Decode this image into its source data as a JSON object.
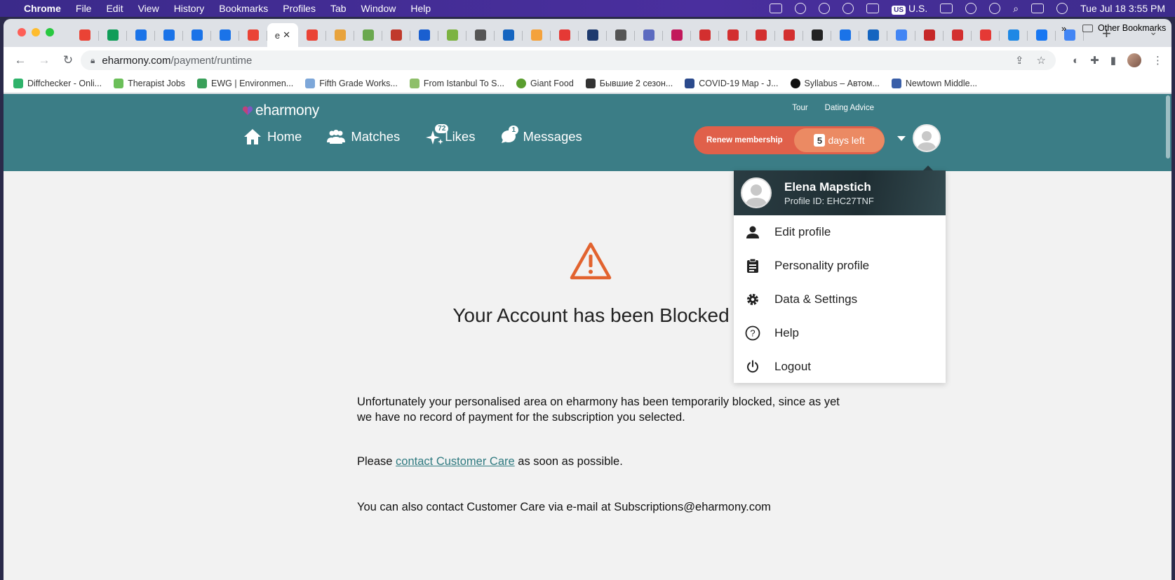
{
  "menubar": {
    "app": "Chrome",
    "items": [
      "File",
      "Edit",
      "View",
      "History",
      "Bookmarks",
      "Profiles",
      "Tab",
      "Window",
      "Help"
    ],
    "keyboard": "U.S.",
    "datetime": "Tue Jul 18  3:55 PM"
  },
  "browser": {
    "url_domain": "eharmony.com",
    "url_path": "/payment/runtime",
    "active_tab_label": "e",
    "bookmarks": [
      {
        "label": "Diffchecker - Onli...",
        "color": "#2fb36b"
      },
      {
        "label": "Therapist Jobs",
        "color": "#6bbf59"
      },
      {
        "label": "EWG | Environmen...",
        "color": "#3aa05a"
      },
      {
        "label": "Fifth Grade Works...",
        "color": "#7da7d9"
      },
      {
        "label": "From Istanbul To S...",
        "color": "#8fbf6a"
      },
      {
        "label": "Giant Food",
        "color": "#5a9e2f"
      },
      {
        "label": "Бывшие 2 сезон...",
        "color": "#333333"
      },
      {
        "label": "COVID-19 Map - J...",
        "color": "#2b4a8c"
      },
      {
        "label": "Syllabus – Автом...",
        "color": "#111111"
      },
      {
        "label": "Newtown Middle...",
        "color": "#3a5fa8"
      }
    ],
    "bookmarks_more": "»",
    "other_bookmarks": "Other Bookmarks"
  },
  "site": {
    "logo": "eharmony",
    "toplinks": [
      "Tour",
      "Dating Advice"
    ],
    "nav": {
      "home": "Home",
      "matches": "Matches",
      "likes": "Likes",
      "likes_badge": "72",
      "messages": "Messages",
      "messages_badge": "1"
    },
    "renew": {
      "label": "Renew membership",
      "days_num": "5",
      "days_text": "days left"
    },
    "accent": "#3b7d86",
    "renew_color": "#e0604a"
  },
  "main": {
    "title": "Your Account has been Blocked",
    "para1": "Unfortunately your personalised area on eharmony has been temporarily blocked, since as yet we have no record of payment for the subscription you selected.",
    "para2_prefix": "Please ",
    "para2_link": "contact Customer Care",
    "para2_suffix": " as soon as possible.",
    "para3": "You can also contact Customer Care via e-mail at Subscriptions@eharmony.com",
    "warning_color": "#e2632f"
  },
  "dropdown": {
    "name": "Elena Mapstich",
    "profile_id": "Profile ID: EHC27TNF",
    "items": [
      {
        "label": "Edit profile",
        "icon": "person-icon"
      },
      {
        "label": "Personality profile",
        "icon": "clipboard-icon"
      },
      {
        "label": "Data & Settings",
        "icon": "gear-icon"
      },
      {
        "label": "Help",
        "icon": "help-icon"
      },
      {
        "label": "Logout",
        "icon": "power-icon"
      }
    ]
  }
}
